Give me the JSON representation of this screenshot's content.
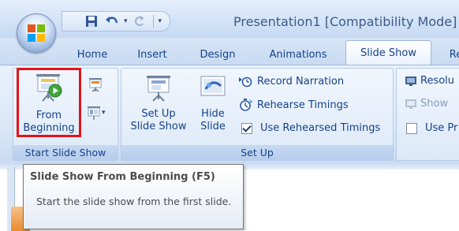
{
  "window": {
    "title": "Presentation1 [Compatibility Mode] -"
  },
  "quick_access": {
    "icons": [
      "save-icon",
      "undo-icon",
      "redo-icon",
      "customize-dropdown-icon"
    ]
  },
  "tabs": [
    {
      "label": "Home"
    },
    {
      "label": "Insert"
    },
    {
      "label": "Design"
    },
    {
      "label": "Animations"
    },
    {
      "label": "Slide Show",
      "active": true
    },
    {
      "label": "Re"
    }
  ],
  "ribbon": {
    "start_group": {
      "label": "Start Slide Show",
      "from_beginning": {
        "line1": "From",
        "line2": "Beginning"
      },
      "icons": [
        "from-current-slide-icon",
        "custom-slide-show-icon"
      ]
    },
    "setup_group": {
      "label": "Set Up",
      "setup_button": {
        "line1": "Set Up",
        "line2": "Slide Show"
      },
      "hide_button": {
        "line1": "Hide",
        "line2": "Slide"
      },
      "record_narration": "Record Narration",
      "rehearse_timings": "Rehearse Timings",
      "use_rehearsed_timings": "Use Rehearsed Timings",
      "use_rehearsed_checked": true
    },
    "monitors_group": {
      "resolution": "Resolu",
      "show_on": "Show",
      "use_presenter": "Use Pr"
    }
  },
  "tooltip": {
    "title": "Slide Show From Beginning (F5)",
    "description": "Start the slide show from the first slide."
  },
  "colors": {
    "highlight": "#e0141b",
    "ribbon_text": "#15428b"
  }
}
